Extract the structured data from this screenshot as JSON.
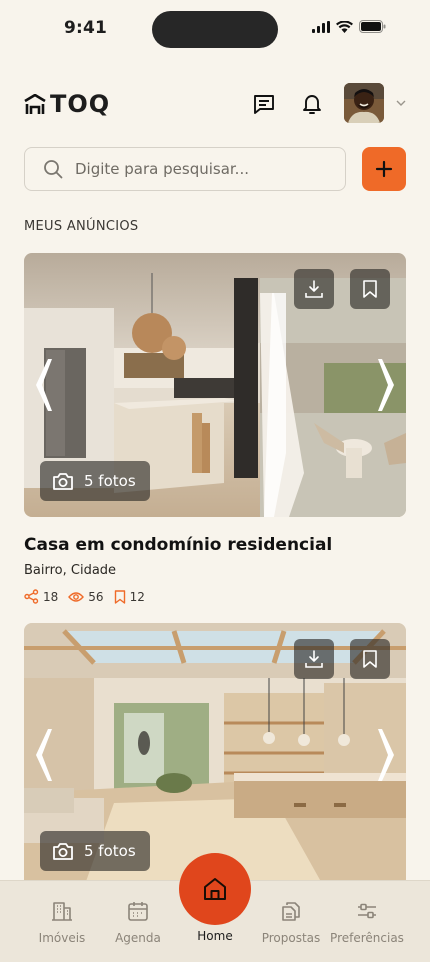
{
  "status_bar": {
    "time": "9:41"
  },
  "header": {
    "logo_text": "TOQ"
  },
  "search": {
    "placeholder": "Digite para pesquisar..."
  },
  "section_title": "MEUS ANÚNCIOS",
  "listings": [
    {
      "photos_label": "5 fotos",
      "title": "Casa em condomínio residencial",
      "location": "Bairro, Cidade",
      "shares": "18",
      "views": "56",
      "saves": "12"
    },
    {
      "photos_label": "5 fotos"
    }
  ],
  "bottom_nav": {
    "items": [
      {
        "label": "Imóveis",
        "icon": "building-icon"
      },
      {
        "label": "Agenda",
        "icon": "calendar-icon"
      },
      {
        "label": "Home",
        "icon": "home-icon"
      },
      {
        "label": "Propostas",
        "icon": "documents-icon"
      },
      {
        "label": "Preferências",
        "icon": "sliders-icon"
      }
    ]
  },
  "colors": {
    "accent": "#ef6a28",
    "home_fab": "#e0461c",
    "background": "#f8f4ec"
  }
}
